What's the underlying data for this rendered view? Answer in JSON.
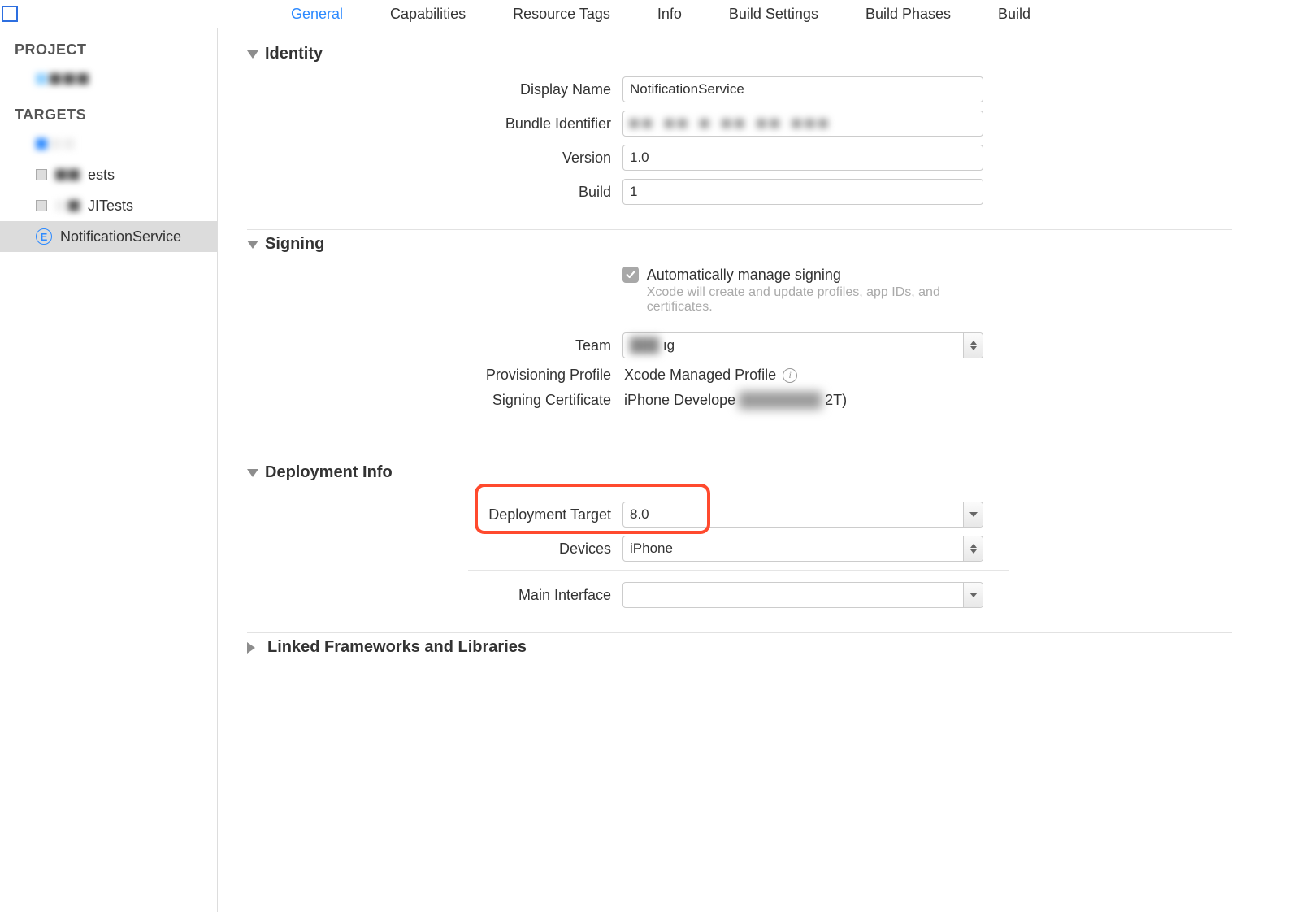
{
  "tabs": {
    "general": "General",
    "capabilities": "Capabilities",
    "resource_tags": "Resource Tags",
    "info": "Info",
    "build_settings": "Build Settings",
    "build_phases": "Build Phases",
    "build_rules": "Build"
  },
  "sidebar": {
    "project_heading": "PROJECT",
    "targets_heading": "TARGETS",
    "item_tests_suffix": "ests",
    "item_uitests_suffix": "JITests",
    "item_notif": "NotificationService",
    "ext_icon_letter": "E"
  },
  "sections": {
    "identity": "Identity",
    "signing": "Signing",
    "deployment_info": "Deployment Info",
    "linked": "Linked Frameworks and Libraries"
  },
  "identity": {
    "display_name_label": "Display Name",
    "display_name_value": "NotificationService",
    "bundle_id_label": "Bundle Identifier",
    "bundle_id_value": "■■ ■■ ■ ■■ ■■ ■■■",
    "version_label": "Version",
    "version_value": "1.0",
    "build_label": "Build",
    "build_value": "1"
  },
  "signing": {
    "auto_label": "Automatically manage signing",
    "auto_sub": "Xcode will create and update profiles, app IDs, and certificates.",
    "team_label": "Team",
    "team_value_suffix": "ıg",
    "prov_label": "Provisioning Profile",
    "prov_value": "Xcode Managed Profile",
    "cert_label": "Signing Certificate",
    "cert_value_prefix": "iPhone Develope",
    "cert_value_suffix": "2T)"
  },
  "deployment": {
    "target_label": "Deployment Target",
    "target_value": "8.0",
    "devices_label": "Devices",
    "devices_value": "iPhone",
    "main_if_label": "Main Interface",
    "main_if_value": ""
  }
}
